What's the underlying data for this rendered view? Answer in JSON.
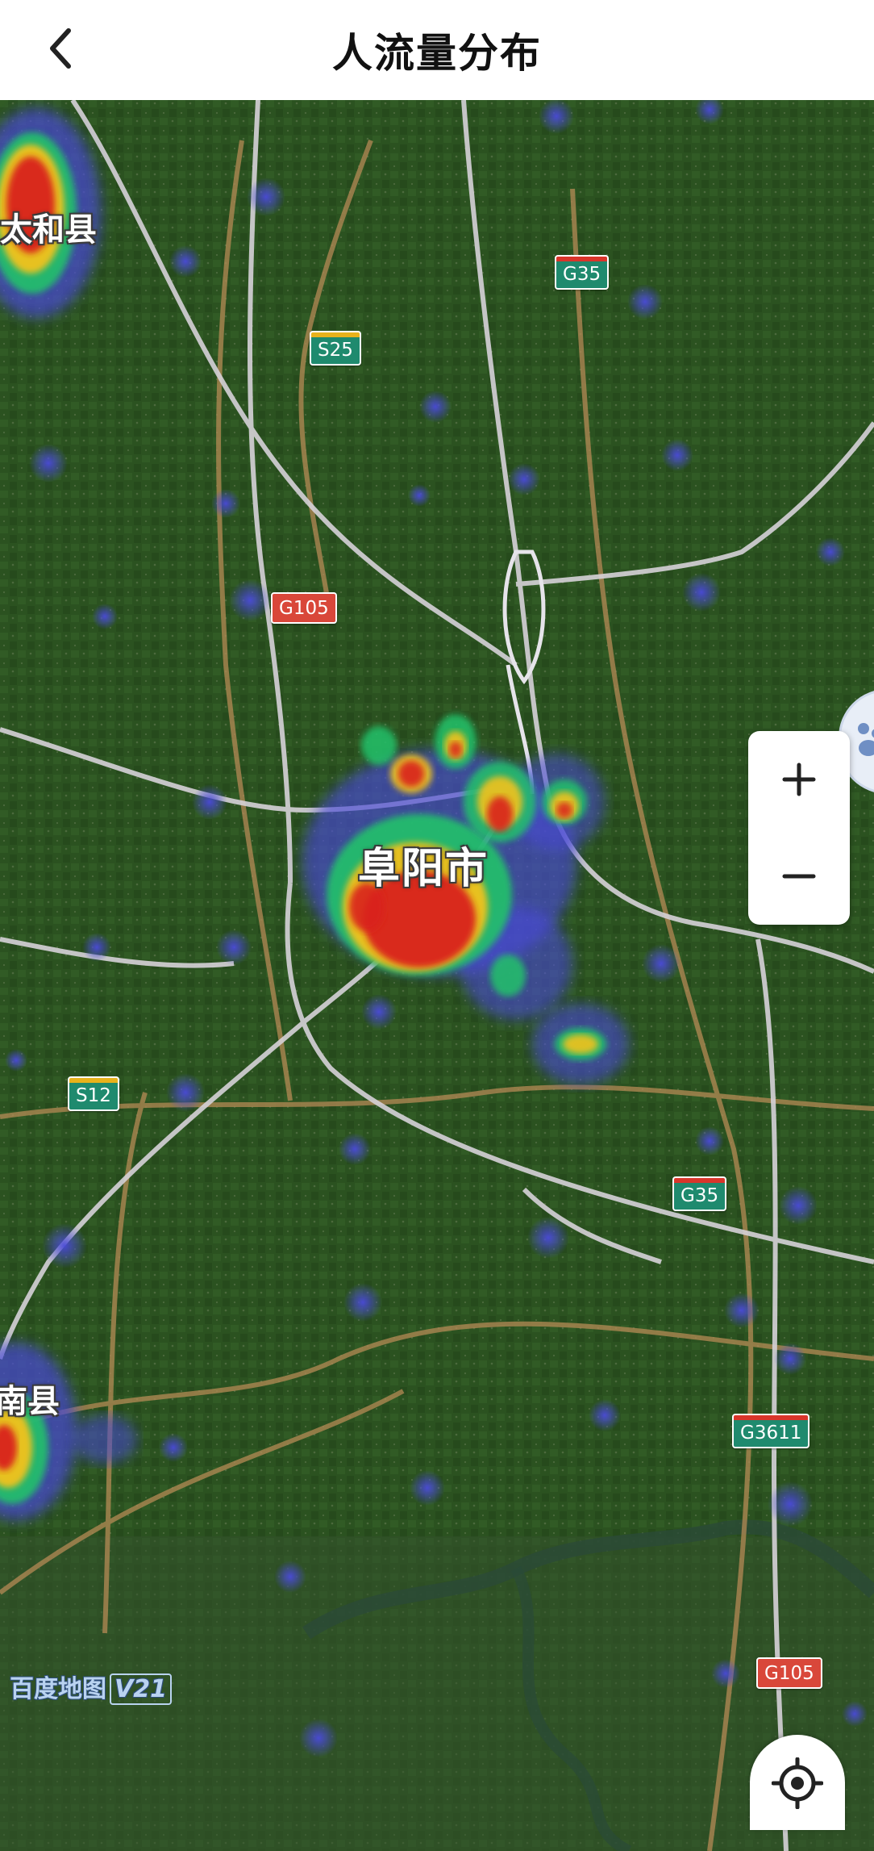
{
  "header": {
    "title": "人流量分布",
    "back_icon": "chevron-left-icon"
  },
  "map": {
    "city_label": "阜阳市",
    "county_labels": [
      "太和县",
      "南县"
    ],
    "road_shields": [
      {
        "id": "g35-top",
        "text": "G35",
        "style": "green"
      },
      {
        "id": "s25",
        "text": "S25",
        "style": "yellow"
      },
      {
        "id": "g105-mid",
        "text": "G105",
        "style": "red"
      },
      {
        "id": "s12",
        "text": "S12",
        "style": "yellow"
      },
      {
        "id": "g35-bottom",
        "text": "G35",
        "style": "green"
      },
      {
        "id": "g3611",
        "text": "G3611",
        "style": "green"
      },
      {
        "id": "g105-bottom",
        "text": "G105",
        "style": "red"
      }
    ],
    "watermark_text": "百度地图",
    "watermark_version": "V21",
    "heat_colors": {
      "low": "#4a4ad8",
      "mid": "#22c26a",
      "high": "#f2c21a",
      "peak": "#d9241c"
    },
    "terrain_color": "#2f5a23"
  },
  "controls": {
    "zoom_in_icon": "plus-icon",
    "zoom_out_icon": "minus-icon",
    "locate_icon": "locate-crosshair-icon"
  }
}
